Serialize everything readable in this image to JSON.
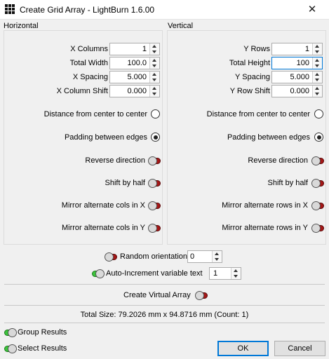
{
  "window": {
    "title": "Create Grid Array - LightBurn 1.6.00",
    "close_glyph": "✕"
  },
  "horizontal": {
    "title": "Horizontal",
    "fields": [
      {
        "label": "X Columns",
        "value": "1"
      },
      {
        "label": "Total Width",
        "value": "100.0"
      },
      {
        "label": "X Spacing",
        "value": "5.000"
      },
      {
        "label": "X Column Shift",
        "value": "0.000"
      }
    ],
    "distance_center_label": "Distance from center to center",
    "padding_edges_label": "Padding between edges",
    "reverse_label": "Reverse direction",
    "shift_half_label": "Shift by half",
    "mirror_x_label": "Mirror alternate cols in X",
    "mirror_y_label": "Mirror alternate cols in Y"
  },
  "vertical": {
    "title": "Vertical",
    "fields": [
      {
        "label": "Y Rows",
        "value": "1"
      },
      {
        "label": "Total Height",
        "value": "100"
      },
      {
        "label": "Y Spacing",
        "value": "5.000"
      },
      {
        "label": "Y Row Shift",
        "value": "0.000"
      }
    ],
    "distance_center_label": "Distance from center to center",
    "padding_edges_label": "Padding between edges",
    "reverse_label": "Reverse direction",
    "shift_half_label": "Shift by half",
    "mirror_x_label": "Mirror alternate rows in X",
    "mirror_y_label": "Mirror alternate rows in Y"
  },
  "random_orientation": {
    "label": "Random orientation",
    "value": "0"
  },
  "auto_increment": {
    "label": "Auto-Increment variable text",
    "value": "1"
  },
  "virtual_array_label": "Create Virtual Array",
  "total_size": "Total Size: 79.2026 mm x 94.8716 mm  (Count: 1)",
  "group_results_label": "Group Results",
  "select_results_label": "Select Results",
  "buttons": {
    "ok": "OK",
    "cancel": "Cancel"
  },
  "colors": {
    "toggle_off": "#a51616",
    "toggle_on": "#3cc43c",
    "focus": "#0078d7"
  },
  "icons": {
    "app": "grid-icon",
    "spin": "spinner-arrows-icon"
  }
}
